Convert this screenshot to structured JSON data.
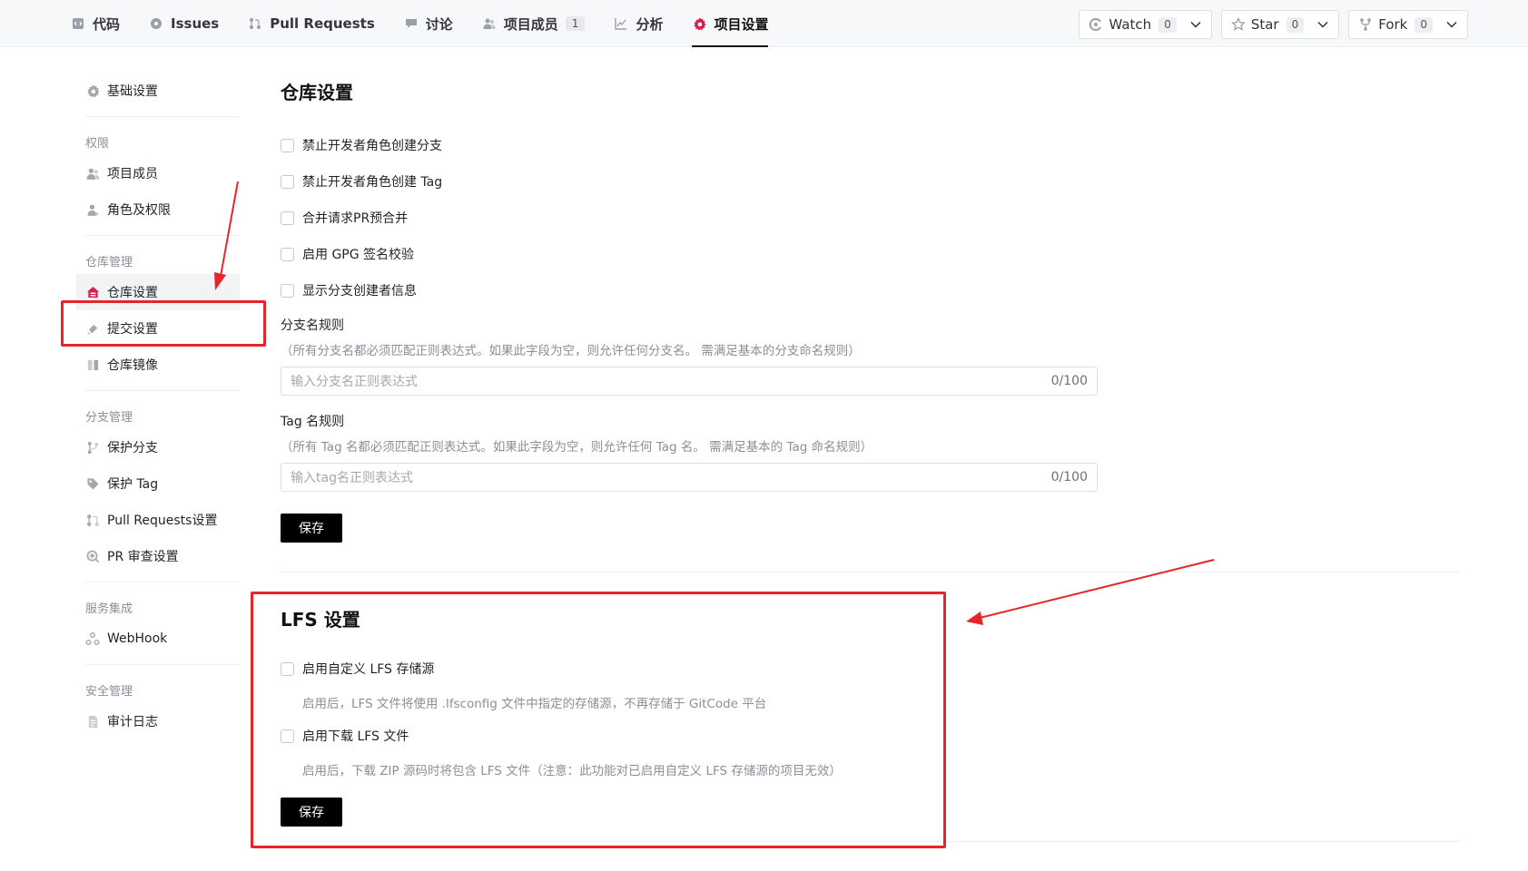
{
  "nav": {
    "items": [
      {
        "label": "代码",
        "icon": "code-icon"
      },
      {
        "label": "Issues",
        "icon": "issues-icon"
      },
      {
        "label": "Pull Requests",
        "icon": "pull-request-icon"
      },
      {
        "label": "讨论",
        "icon": "discussion-icon"
      },
      {
        "label": "项目成员",
        "icon": "members-icon",
        "badge": "1"
      },
      {
        "label": "分析",
        "icon": "chart-icon"
      },
      {
        "label": "项目设置",
        "icon": "gear-icon",
        "active": true
      }
    ]
  },
  "actions": {
    "watch": {
      "label": "Watch",
      "count": "0"
    },
    "star": {
      "label": "Star",
      "count": "0"
    },
    "fork": {
      "label": "Fork",
      "count": "0"
    }
  },
  "sidebar": {
    "basic": "基础设置",
    "groups": [
      {
        "title": "权限",
        "items": [
          "项目成员",
          "角色及权限"
        ]
      },
      {
        "title": "仓库管理",
        "items": [
          "仓库设置",
          "提交设置",
          "仓库镜像"
        ]
      },
      {
        "title": "分支管理",
        "items": [
          "保护分支",
          "保护 Tag",
          "Pull Requests设置",
          "PR 审查设置"
        ]
      },
      {
        "title": "服务集成",
        "items": [
          "WebHook"
        ]
      },
      {
        "title": "安全管理",
        "items": [
          "审计日志"
        ]
      }
    ]
  },
  "repo_settings": {
    "title": "仓库设置",
    "options": [
      "禁止开发者角色创建分支",
      "禁止开发者角色创建 Tag",
      "合并请求PR预合并",
      "启用 GPG 签名校验",
      "显示分支创建者信息"
    ],
    "branch_rule": {
      "label": "分支名规则",
      "help": "（所有分支名都必须匹配正则表达式。如果此字段为空，则允许任何分支名。 需满足基本的分支命名规则）",
      "placeholder": "输入分支名正则表达式",
      "count": "0/100"
    },
    "tag_rule": {
      "label": "Tag 名规则",
      "help": "（所有 Tag 名都必须匹配正则表达式。如果此字段为空，则允许任何 Tag 名。 需满足基本的 Tag 命名规则）",
      "placeholder": "输入tag名正则表达式",
      "count": "0/100"
    },
    "save": "保存"
  },
  "lfs_settings": {
    "title": "LFS 设置",
    "custom_source": "启用自定义 LFS 存储源",
    "custom_source_help": "启用后，LFS 文件将使用 .lfsconfig 文件中指定的存储源，不再存储于 GitCode 平台",
    "download": "启用下载 LFS 文件",
    "download_help": "启用后，下载 ZIP 源码时将包含 LFS 文件（注意：此功能对已启用自定义 LFS 存储源的项目无效）",
    "save": "保存"
  },
  "colors": {
    "accent": "#e8242b",
    "active_icon": "#d6204f"
  }
}
